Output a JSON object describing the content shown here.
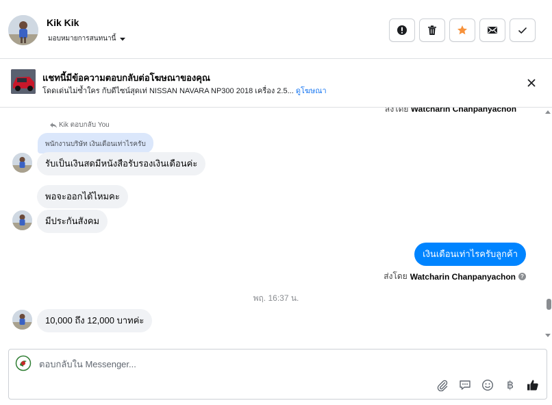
{
  "header": {
    "contact_name": "Kik Kik",
    "assign_label": "มอบหมายการสนทนานี้",
    "tools": [
      "spam-icon",
      "trash-icon",
      "star-icon",
      "envelope-icon",
      "check-icon"
    ]
  },
  "ad": {
    "title": "แชทนี้มีข้อความตอบกลับต่อโฆษณาของคุณ",
    "subtitle": "โดดเด่นไม่ซ้ำใคร กับดีไซน์สุดเท่ NISSAN NAVARA NP300 2018 เครื่อง 2.5...",
    "link": "ดูโฆษณา"
  },
  "thread": {
    "cut_sent_by_prefix": "ส่งโดย",
    "cut_sent_by_name": "Watcharin Chanpanyachon",
    "reply_note": "Kik ตอบกลับ You",
    "quoted_text": "พนักงานบริษัท เงินเดือนเท่าไรครับ",
    "msg1": "รับเป็นเงินสดมีหนังสือรับรองเงินเดือนค่ะ",
    "msg2": "พอจะออกได้ไหมคะ",
    "msg3": "มีประกันสังคม",
    "msg_out": "เงินเดือนเท่าไรครับลูกค้า",
    "sent_by_prefix": "ส่งโดย",
    "sent_by_name": "Watcharin Chanpanyachon",
    "timestamp": "พฤ. 16:37 น.",
    "msg4": "10,000 ถึง 12,000 บาทค่ะ"
  },
  "composer": {
    "placeholder": "ตอบกลับใน Messenger...",
    "actions": [
      "paperclip-icon",
      "quick-reply-icon",
      "emoji-icon",
      "baht-icon",
      "like-icon"
    ],
    "baht_symbol": "฿"
  },
  "colors": {
    "accent": "#1877f2",
    "outgoing_bubble": "#0084ff",
    "incoming_bubble": "#f0f2f5",
    "quoted_bubble": "#dbe7fb",
    "star": "#f7923b"
  }
}
